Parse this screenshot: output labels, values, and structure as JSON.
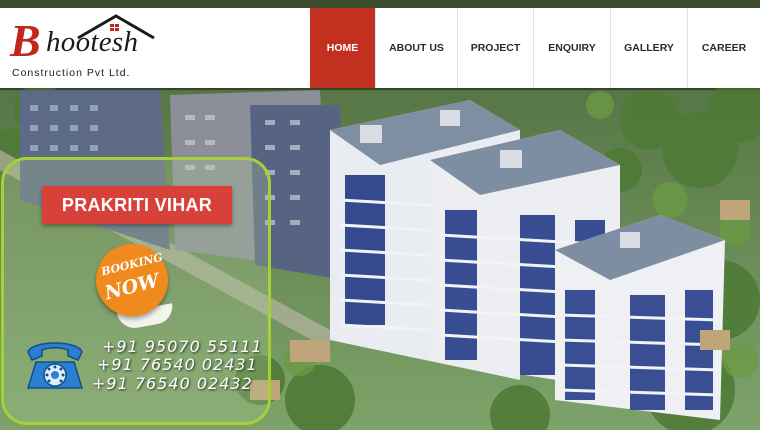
{
  "brand": {
    "initial": "B",
    "name": "hootesh",
    "tagline": "Construction Pvt Ltd."
  },
  "nav": {
    "items": [
      {
        "label": "HOME",
        "active": true
      },
      {
        "label": "ABOUT US",
        "active": false
      },
      {
        "label": "PROJECT",
        "active": false
      },
      {
        "label": "ENQUIRY",
        "active": false
      },
      {
        "label": "GALLERY",
        "active": false
      },
      {
        "label": "CAREER",
        "active": false
      }
    ]
  },
  "promo": {
    "project_name": "PRAKRITI VIHAR",
    "booking_top": "BOOKING",
    "booking_bottom": "NOW",
    "phones": [
      "+91 95070 55111",
      "+91 76540 02431",
      "+91 76540 02432"
    ]
  },
  "colors": {
    "accent": "#c2301f",
    "panel_border": "#a5d03a",
    "badge": "#d8413a",
    "booking": "#f08a1e"
  }
}
